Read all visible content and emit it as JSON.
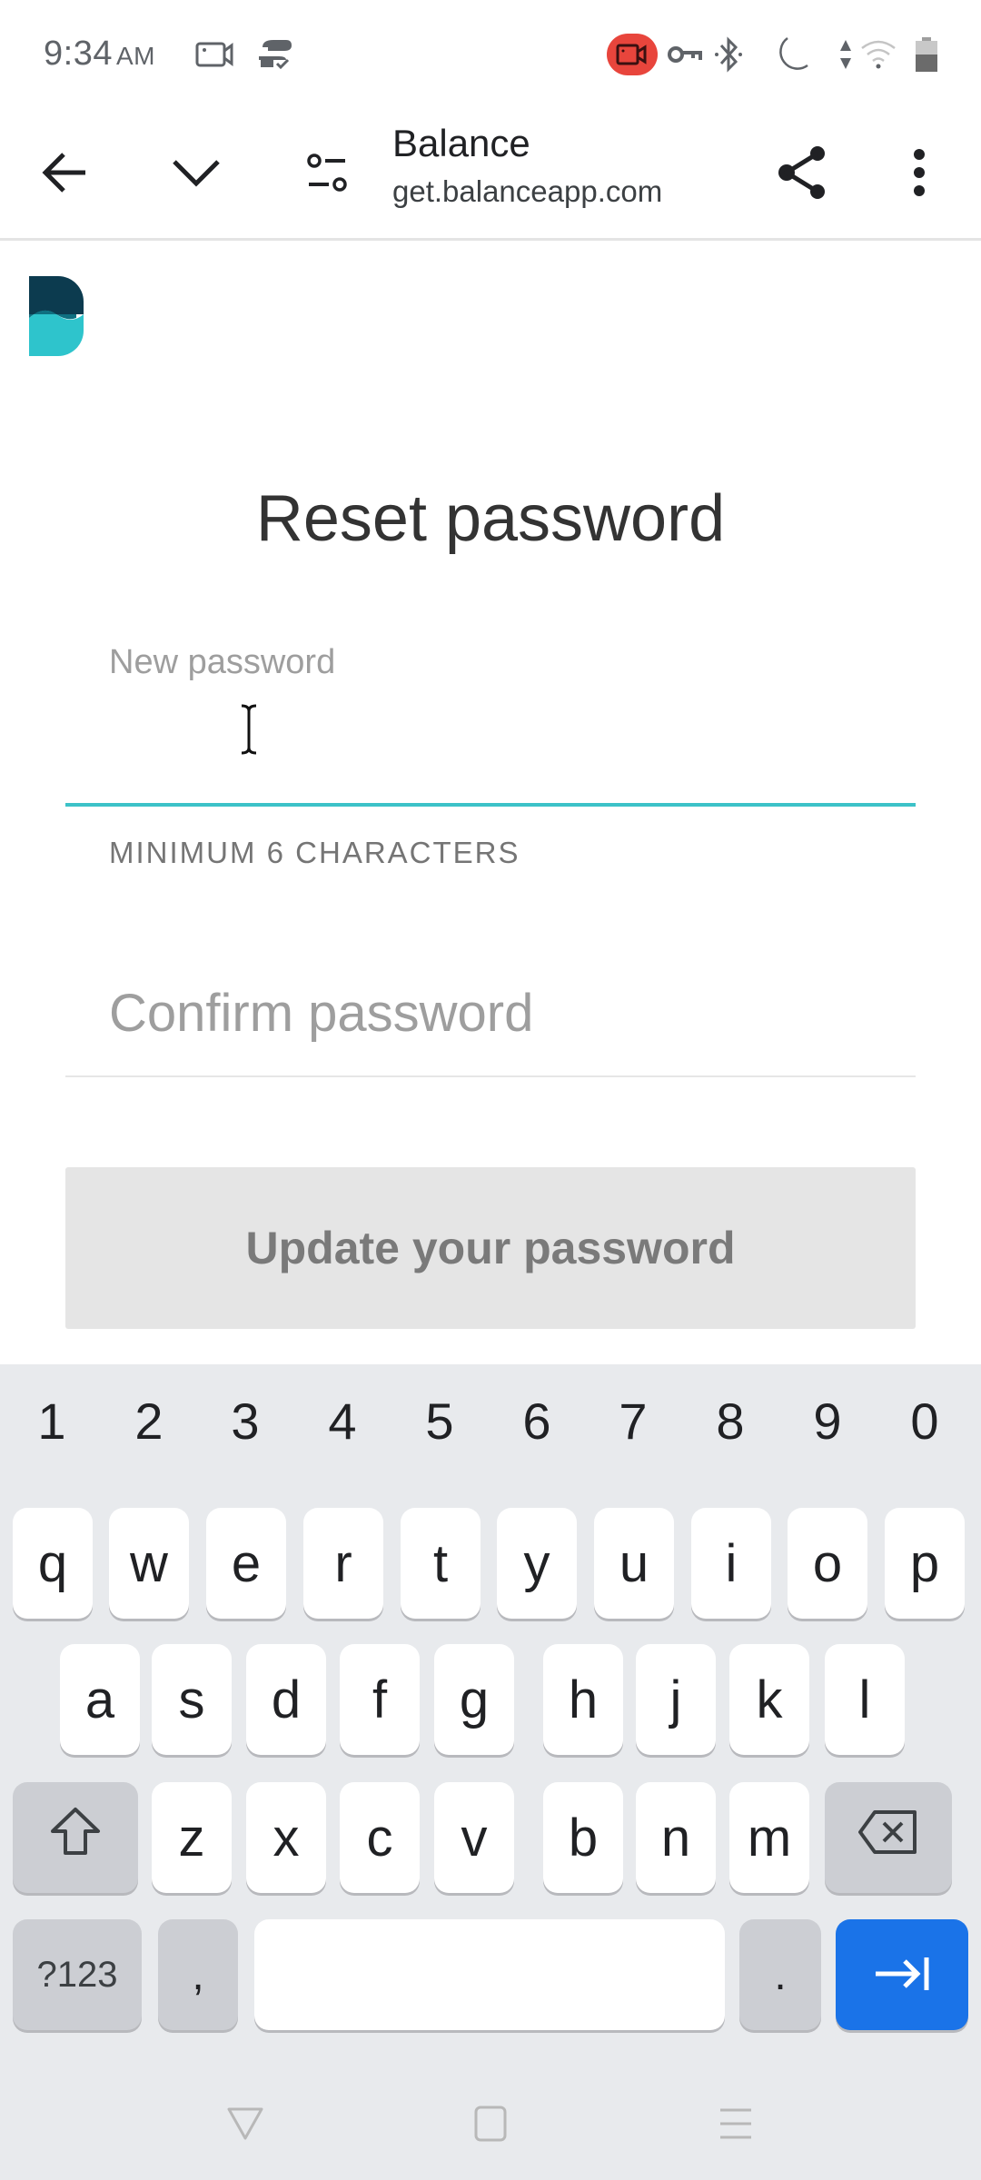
{
  "status_bar": {
    "time": "9:34",
    "ampm": "AM",
    "icons": [
      "screen-record-icon",
      "sync-icon",
      "recording-badge-icon",
      "vpn-key-icon",
      "bluetooth-icon",
      "do-not-disturb-icon",
      "data-arrows-icon",
      "wifi-icon",
      "battery-icon"
    ]
  },
  "browser": {
    "title": "Balance",
    "url": "get.balanceapp.com",
    "icons": [
      "back-arrow-icon",
      "chevron-down-icon",
      "site-settings-icon",
      "share-icon",
      "more-vert-icon"
    ]
  },
  "page": {
    "logo": "balance-logo",
    "title": "Reset password",
    "new_password_label": "New password",
    "new_password_value": "",
    "hint": "MINIMUM 6 CHARACTERS",
    "confirm_placeholder": "Confirm password",
    "confirm_value": "",
    "submit_label": "Update your password",
    "colors": {
      "accent": "#3cc2c8",
      "logo_dark": "#0c3b4f",
      "logo_light": "#2ec4cc",
      "button_bg": "#e5e5e5",
      "button_text": "#7a7a7a"
    }
  },
  "keyboard": {
    "numbers": [
      "1",
      "2",
      "3",
      "4",
      "5",
      "6",
      "7",
      "8",
      "9",
      "0"
    ],
    "row1": [
      "q",
      "w",
      "e",
      "r",
      "t",
      "y",
      "u",
      "i",
      "o",
      "p"
    ],
    "row2": [
      "a",
      "s",
      "d",
      "f",
      "g",
      "h",
      "j",
      "k",
      "l"
    ],
    "row3": [
      "z",
      "x",
      "c",
      "v",
      "b",
      "n",
      "m"
    ],
    "symbols_label": "?123",
    "comma": ",",
    "period": ".",
    "enter_color": "#1a73e8"
  },
  "nav_bar": {
    "icons": [
      "back-triangle-icon",
      "home-square-icon",
      "recents-menu-icon"
    ]
  }
}
